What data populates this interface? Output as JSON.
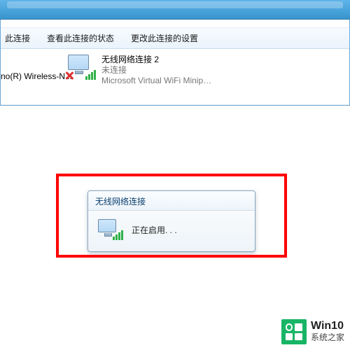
{
  "toolbar": {
    "disable": "此连接",
    "status": "查看此连接的状态",
    "settings": "更改此连接的设置"
  },
  "adapters": {
    "left_label": "no(R) Wireless-N...",
    "right": {
      "name": "无线网络连接 2",
      "status": "未连接",
      "desc": "Microsoft Virtual WiFi Minipor..."
    }
  },
  "dialog": {
    "title": "无线网络连接",
    "message": "正在启用. . ."
  },
  "watermark": {
    "top": "Win10",
    "bot": "系统之家"
  }
}
